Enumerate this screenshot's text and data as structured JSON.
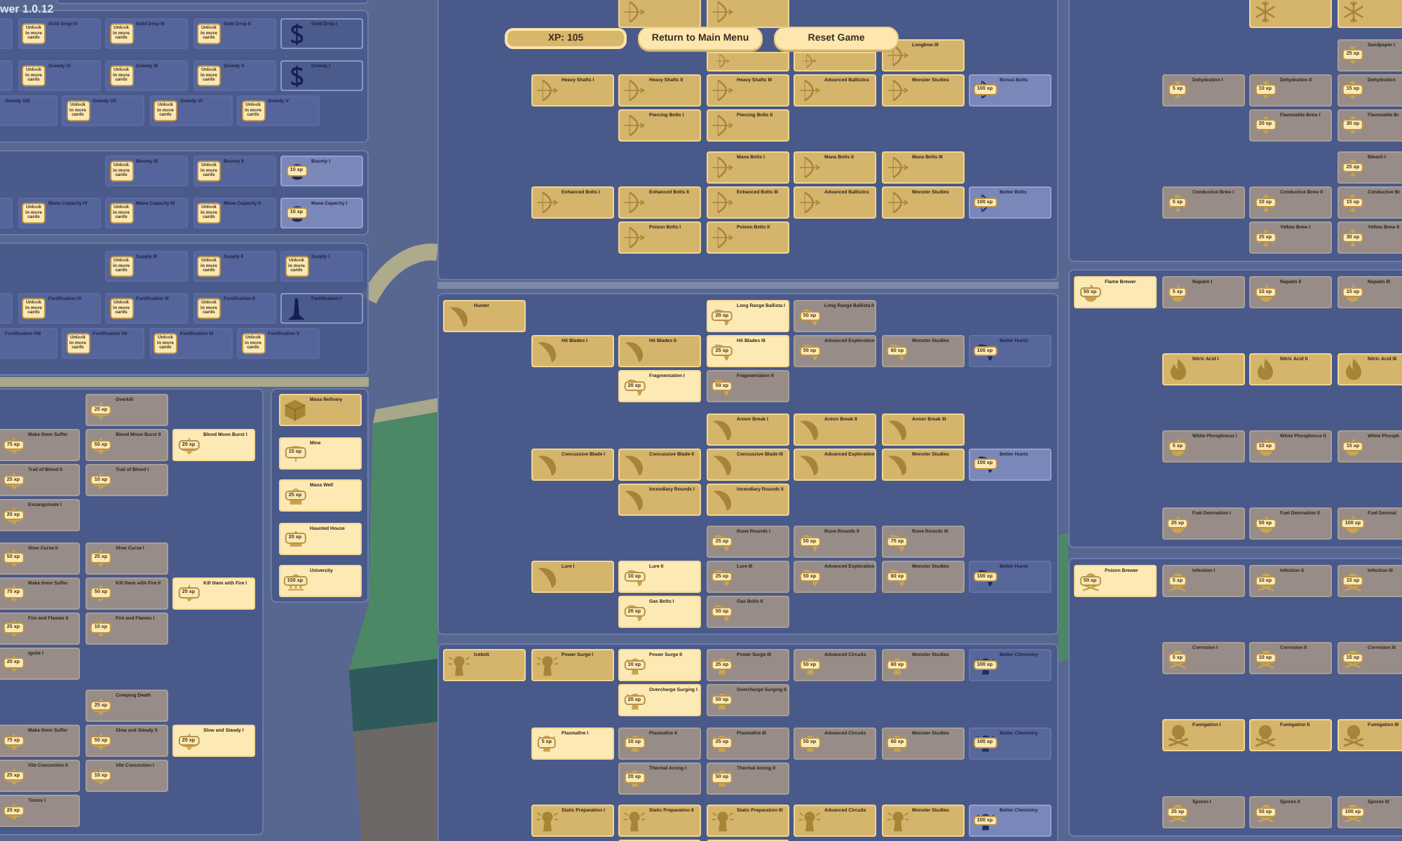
{
  "version": "wer 1.0.12",
  "hud": {
    "xp": "XP: 105",
    "buttons": [
      "Return to Main Menu",
      "Reset Game"
    ]
  },
  "upgrade_panels": [
    {
      "sections": [
        {
          "rows": [
            [
              {
                "kind": "sealed"
              },
              {
                "title": "Gold Drop IV",
                "kind": "sealed",
                "cost": "Unlock in more cards"
              },
              {
                "title": "Gold Drop III",
                "kind": "sealed",
                "cost": "Unlock in more cards"
              },
              {
                "title": "Gold Drop II",
                "kind": "sealed",
                "cost": "Unlock in more cards"
              },
              {
                "title": "Gold Drop I",
                "kind": "outlined"
              }
            ]
          ]
        },
        {
          "rows": [
            [
              {
                "kind": "sealed"
              },
              {
                "title": "Greedy IV",
                "kind": "sealed",
                "cost": "Unlock in more cards"
              },
              {
                "title": "Greedy III",
                "kind": "sealed",
                "cost": "Unlock in more cards"
              },
              {
                "title": "Greedy II",
                "kind": "sealed",
                "cost": "Unlock in more cards"
              },
              {
                "title": "Greedy I",
                "kind": "outlined"
              }
            ],
            [
              {
                "title": "Greedy VIII",
                "kind": "sealed"
              },
              {
                "title": "Greedy VII",
                "kind": "sealed",
                "cost": "Unlock in more cards"
              },
              {
                "title": "Greedy VI",
                "kind": "sealed",
                "cost": "Unlock in more cards"
              },
              {
                "title": "Greedy V",
                "kind": "sealed",
                "cost": "Unlock in more cards"
              }
            ]
          ]
        }
      ]
    },
    {
      "sections": [
        {
          "rows": [
            [
              {
                "title": "Bounty III",
                "kind": "sealed",
                "cost": "Unlock in more cards"
              },
              {
                "title": "Bounty II",
                "kind": "sealed",
                "cost": "Unlock in more cards"
              },
              {
                "title": "Bounty I",
                "kind": "capstone",
                "cost": "10 xp"
              }
            ]
          ]
        },
        {
          "rows": [
            [
              {
                "kind": "sealed"
              },
              {
                "title": "Mana Capacity IV",
                "kind": "sealed",
                "cost": "Unlock in more cards"
              },
              {
                "title": "Mana Capacity III",
                "kind": "sealed",
                "cost": "Unlock in more cards"
              },
              {
                "title": "Mana Capacity II",
                "kind": "sealed",
                "cost": "Unlock in more cards"
              },
              {
                "title": "Mana Capacity I",
                "kind": "capstone",
                "cost": "10 xp"
              }
            ]
          ]
        }
      ]
    },
    {
      "sections": [
        {
          "rows": [
            [
              {
                "title": "Supply III",
                "kind": "sealed",
                "cost": "Unlock in more cards"
              },
              {
                "title": "Supply II",
                "kind": "sealed",
                "cost": "Unlock in more cards"
              },
              {
                "title": "Supply I",
                "kind": "sealed",
                "cost": "Unlock in more cards"
              }
            ]
          ]
        },
        {
          "rows": [
            [
              {
                "kind": "sealed"
              },
              {
                "title": "Fortification IV",
                "kind": "sealed",
                "cost": "Unlock in more cards"
              },
              {
                "title": "Fortification III",
                "kind": "sealed",
                "cost": "Unlock in more cards"
              },
              {
                "title": "Fortification II",
                "kind": "sealed",
                "cost": "Unlock in more cards"
              },
              {
                "title": "Fortification I",
                "kind": "outlined"
              }
            ],
            [
              {
                "title": "Fortification VIII",
                "kind": "sealed"
              },
              {
                "title": "Fortification VII",
                "kind": "sealed",
                "cost": "Unlock in more cards"
              },
              {
                "title": "Fortification VI",
                "kind": "sealed",
                "cost": "Unlock in more cards"
              },
              {
                "title": "Fortification V",
                "kind": "sealed",
                "cost": "Unlock in more cards"
              }
            ]
          ]
        }
      ]
    }
  ],
  "curse_tree": {
    "sections": [
      {
        "rows": [
          [
            null,
            {
              "title": "Overkill",
              "kind": "locked",
              "cost": "25 xp"
            }
          ],
          [
            {
              "title": "Make them Suffer",
              "kind": "locked",
              "cost": "75 xp"
            },
            {
              "title": "Blood Moon Burst II",
              "kind": "locked",
              "cost": "50 xp"
            },
            {
              "title": "Blood Moon Burst I",
              "kind": "available",
              "cost": "20 xp"
            }
          ],
          [
            {
              "title": "Trail of Blood II",
              "kind": "locked",
              "cost": "25 xp"
            },
            {
              "title": "Trail of Blood I",
              "kind": "locked",
              "cost": "10 xp"
            }
          ],
          [
            {
              "title": "Exsanguinate I",
              "kind": "locked",
              "cost": "20 xp"
            }
          ]
        ]
      },
      {
        "rows": [
          [
            {
              "title": "Slow Curse II",
              "kind": "locked",
              "cost": "50 xp"
            },
            {
              "title": "Slow Curse I",
              "kind": "locked",
              "cost": "25 xp"
            }
          ],
          [
            {
              "title": "Make them Suffer",
              "kind": "locked",
              "cost": "75 xp"
            },
            {
              "title": "Kill them with Fire II",
              "kind": "locked",
              "cost": "50 xp"
            },
            {
              "title": "Kill them with Fire I",
              "kind": "available",
              "cost": "20 xp"
            }
          ],
          [
            {
              "title": "Fire and Flames II",
              "kind": "locked",
              "cost": "25 xp"
            },
            {
              "title": "Fire and Flames I",
              "kind": "locked",
              "cost": "10 xp"
            }
          ],
          [
            {
              "title": "Ignite I",
              "kind": "locked",
              "cost": "20 xp"
            }
          ]
        ]
      },
      {
        "rows": [
          [
            null,
            {
              "title": "Creeping Death",
              "kind": "locked",
              "cost": "25 xp"
            }
          ],
          [
            {
              "title": "Make them Suffer",
              "kind": "locked",
              "cost": "75 xp"
            },
            {
              "title": "Slow and Steady II",
              "kind": "locked",
              "cost": "50 xp"
            },
            {
              "title": "Slow and Steady I",
              "kind": "available",
              "cost": "20 xp"
            }
          ],
          [
            {
              "title": "Vile Concoction II",
              "kind": "locked",
              "cost": "25 xp"
            },
            {
              "title": "Vile Concoction I",
              "kind": "locked",
              "cost": "10 xp"
            }
          ],
          [
            {
              "title": "Toxins I",
              "kind": "locked",
              "cost": "20 xp"
            }
          ]
        ]
      }
    ]
  },
  "buildings": [
    {
      "title": "Mana Refinery",
      "kind": "owned"
    },
    {
      "title": "Mine",
      "kind": "available",
      "cost": "15 xp"
    },
    {
      "title": "Mana Well",
      "kind": "available",
      "cost": "25 xp"
    },
    {
      "title": "Haunted House",
      "kind": "available",
      "cost": "20 xp"
    },
    {
      "title": "University",
      "kind": "available",
      "cost": "150 xp"
    }
  ],
  "center_panels": [
    {
      "sections": [
        {
          "rows": [
            [
              null,
              null,
              {
                "kind": "owned"
              },
              {
                "kind": "owned"
              }
            ]
          ]
        },
        {
          "rows": [
            [
              null,
              null,
              null,
              {
                "kind": "owned"
              },
              {
                "kind": "owned"
              },
              {
                "title": "Longbow III",
                "kind": "owned"
              }
            ],
            [
              null,
              {
                "title": "Heavy Shafts I",
                "kind": "owned"
              },
              {
                "title": "Heavy Shafts II",
                "kind": "owned"
              },
              {
                "title": "Heavy Shafts III",
                "kind": "owned"
              },
              {
                "title": "Advanced Ballistics",
                "kind": "owned"
              },
              {
                "title": "Monster Studies",
                "kind": "owned"
              },
              {
                "title": "Bonus Bolts",
                "kind": "capstone",
                "cost": "100 xp"
              }
            ],
            [
              null,
              null,
              {
                "title": "Piercing Bolts I",
                "kind": "owned"
              },
              {
                "title": "Piercing Bolts II",
                "kind": "owned"
              }
            ]
          ]
        },
        {
          "rows": [
            [
              null,
              null,
              null,
              {
                "title": "Mana Bolts I",
                "kind": "owned"
              },
              {
                "title": "Mana Bolts II",
                "kind": "owned"
              },
              {
                "title": "Mana Bolts III",
                "kind": "owned"
              }
            ],
            [
              null,
              {
                "title": "Enhanced Bolts I",
                "kind": "owned"
              },
              {
                "title": "Enhanced Bolts II",
                "kind": "owned"
              },
              {
                "title": "Enhanced Bolts III",
                "kind": "owned"
              },
              {
                "title": "Advanced Ballistics",
                "kind": "owned"
              },
              {
                "title": "Monster Studies",
                "kind": "owned"
              },
              {
                "title": "Better Bolts",
                "kind": "capstone",
                "cost": "100 xp"
              }
            ],
            [
              null,
              null,
              {
                "title": "Poison Bolts I",
                "kind": "owned"
              },
              {
                "title": "Poison Bolts II",
                "kind": "owned"
              }
            ]
          ]
        }
      ]
    },
    {
      "sections": [
        {
          "rows": [
            [
              {
                "title": "Hunter",
                "kind": "owned"
              },
              null,
              null,
              {
                "title": "Long Range Ballista I",
                "kind": "available",
                "cost": "20 xp"
              },
              {
                "title": "Long Range Ballista II",
                "kind": "locked",
                "cost": "50 xp"
              }
            ],
            [
              null,
              {
                "title": "Hit Blades I",
                "kind": "owned"
              },
              {
                "title": "Hit Blades II",
                "kind": "owned"
              },
              {
                "title": "Hit Blades III",
                "kind": "available",
                "cost": "25 xp"
              },
              {
                "title": "Advanced Exploration",
                "kind": "locked",
                "cost": "50 xp"
              },
              {
                "title": "Monster Studies",
                "kind": "locked",
                "cost": "60 xp"
              },
              {
                "title": "Better Hunts",
                "kind": "capstone_locked",
                "cost": "100 xp"
              }
            ],
            [
              null,
              null,
              {
                "title": "Fragmentation I",
                "kind": "available",
                "cost": "20 xp"
              },
              {
                "title": "Fragmentation II",
                "kind": "locked",
                "cost": "50 xp"
              }
            ]
          ]
        },
        {
          "rows": [
            [
              null,
              null,
              null,
              {
                "title": "Armor Break I",
                "kind": "owned"
              },
              {
                "title": "Armor Break II",
                "kind": "owned"
              },
              {
                "title": "Armor Break III",
                "kind": "owned"
              }
            ],
            [
              null,
              {
                "title": "Concussive Blade I",
                "kind": "owned"
              },
              {
                "title": "Concussive Blade II",
                "kind": "owned"
              },
              {
                "title": "Concussive Blade III",
                "kind": "owned"
              },
              {
                "title": "Advanced Exploration",
                "kind": "owned"
              },
              {
                "title": "Monster Studies",
                "kind": "owned"
              },
              {
                "title": "Better Hunts",
                "kind": "capstone",
                "cost": "100 xp"
              }
            ],
            [
              null,
              null,
              {
                "title": "Incendiary Rounds I",
                "kind": "owned"
              },
              {
                "title": "Incendiary Rounds II",
                "kind": "owned"
              }
            ]
          ]
        },
        {
          "rows": [
            [
              null,
              null,
              null,
              {
                "title": "Rune Rounds I",
                "kind": "locked",
                "cost": "25 xp"
              },
              {
                "title": "Rune Rounds II",
                "kind": "locked",
                "cost": "50 xp"
              },
              {
                "title": "Rune Rounds III",
                "kind": "locked",
                "cost": "75 xp"
              }
            ],
            [
              null,
              {
                "title": "Lure I",
                "kind": "owned"
              },
              {
                "title": "Lure II",
                "kind": "available",
                "cost": "10 xp"
              },
              {
                "title": "Lure III",
                "kind": "locked",
                "cost": "25 xp"
              },
              {
                "title": "Advanced Exploration",
                "kind": "locked",
                "cost": "50 xp"
              },
              {
                "title": "Monster Studies",
                "kind": "locked",
                "cost": "60 xp"
              },
              {
                "title": "Better Hunts",
                "kind": "capstone_locked",
                "cost": "100 xp"
              }
            ],
            [
              null,
              null,
              {
                "title": "Gas Bolts I",
                "kind": "available",
                "cost": "20 xp"
              },
              {
                "title": "Gas Bolts II",
                "kind": "locked",
                "cost": "50 xp"
              }
            ]
          ]
        }
      ]
    },
    {
      "sections": [
        {
          "rows": [
            [
              {
                "title": "Icebolt",
                "kind": "owned"
              },
              {
                "title": "Power Surge I",
                "kind": "owned"
              },
              {
                "title": "Power Surge II",
                "kind": "available",
                "cost": "10 xp"
              },
              {
                "title": "Power Surge III",
                "kind": "locked",
                "cost": "25 xp"
              },
              {
                "title": "Advanced Circuits",
                "kind": "locked",
                "cost": "50 xp"
              },
              {
                "title": "Monster Studies",
                "kind": "locked",
                "cost": "60 xp"
              },
              {
                "title": "Better Chemistry",
                "kind": "capstone_locked",
                "cost": "100 xp"
              }
            ],
            [
              null,
              null,
              {
                "title": "Overcharge Surging I",
                "kind": "available",
                "cost": "20 xp"
              },
              {
                "title": "Overcharge Surging II",
                "kind": "locked",
                "cost": "50 xp"
              }
            ]
          ]
        },
        {
          "rows": [
            [
              null,
              {
                "title": "Plasmafire I",
                "kind": "available",
                "cost": "5 xp"
              },
              {
                "title": "Plasmafire II",
                "kind": "locked",
                "cost": "10 xp"
              },
              {
                "title": "Plasmafire III",
                "kind": "locked",
                "cost": "25 xp"
              },
              {
                "title": "Advanced Circuits",
                "kind": "locked",
                "cost": "50 xp"
              },
              {
                "title": "Monster Studies",
                "kind": "locked",
                "cost": "60 xp"
              },
              {
                "title": "Better Chemistry",
                "kind": "capstone_locked",
                "cost": "100 xp"
              }
            ],
            [
              null,
              null,
              {
                "title": "Thermal Arcing I",
                "kind": "locked",
                "cost": "20 xp"
              },
              {
                "title": "Thermal Arcing II",
                "kind": "locked",
                "cost": "50 xp"
              }
            ]
          ]
        },
        {
          "rows": [
            [
              null,
              {
                "title": "Static Preparation I",
                "kind": "owned"
              },
              {
                "title": "Static Preparation II",
                "kind": "owned"
              },
              {
                "title": "Static Preparation III",
                "kind": "owned"
              },
              {
                "title": "Advanced Circuits",
                "kind": "owned"
              },
              {
                "title": "Monster Studies",
                "kind": "owned"
              },
              {
                "title": "Better Chemistry",
                "kind": "capstone",
                "cost": "100 xp"
              }
            ],
            [
              null,
              null,
              {
                "kind": "owned"
              },
              {
                "kind": "owned"
              }
            ]
          ]
        }
      ]
    }
  ],
  "right_panels": [
    {
      "sections": [
        {
          "rows": [
            [
              null,
              null,
              {
                "kind": "owned"
              },
              {
                "kind": "owned"
              }
            ]
          ]
        },
        {
          "rows": [
            [
              null,
              null,
              null,
              {
                "title": "Sandpaper I",
                "kind": "locked",
                "cost": "25 xp"
              }
            ],
            [
              null,
              {
                "title": "Dehydration I",
                "kind": "locked",
                "cost": "5 xp"
              },
              {
                "title": "Dehydration II",
                "kind": "locked",
                "cost": "10 xp"
              },
              {
                "title": "Dehydration",
                "kind": "locked",
                "cost": "15 xp"
              }
            ],
            [
              null,
              null,
              {
                "title": "Flammable Brew I",
                "kind": "locked",
                "cost": "20 xp"
              },
              {
                "title": "Flammable Br",
                "kind": "locked",
                "cost": "30 xp"
              }
            ]
          ]
        },
        {
          "rows": [
            [
              null,
              null,
              null,
              {
                "title": "Bleach I",
                "kind": "locked",
                "cost": "25 xp"
              }
            ],
            [
              null,
              {
                "title": "Conductive Brew I",
                "kind": "locked",
                "cost": "5 xp"
              },
              {
                "title": "Conductive Brew II",
                "kind": "locked",
                "cost": "10 xp"
              },
              {
                "title": "Conductive Br",
                "kind": "locked",
                "cost": "15 xp"
              }
            ],
            [
              null,
              null,
              {
                "title": "Yellow Brew I",
                "kind": "locked",
                "cost": "25 xp"
              },
              {
                "title": "Yellow Brew II",
                "kind": "locked",
                "cost": "30 xp"
              }
            ]
          ]
        }
      ]
    },
    {
      "sections": [
        {
          "rows": [
            [
              {
                "title": "Flame Brewer",
                "kind": "available",
                "cost": "50 xp"
              },
              {
                "title": "Napalm I",
                "kind": "locked",
                "cost": "5 xp"
              },
              {
                "title": "Napalm II",
                "kind": "locked",
                "cost": "10 xp"
              },
              {
                "title": "Napalm III",
                "kind": "locked",
                "cost": "15 xp"
              }
            ]
          ]
        },
        {
          "rows": [
            [
              null,
              {
                "title": "Nitric Acid I",
                "kind": "owned"
              },
              {
                "title": "Nitric Acid II",
                "kind": "owned"
              },
              {
                "title": "Nitric Acid III",
                "kind": "owned"
              }
            ]
          ]
        },
        {
          "rows": [
            [
              null,
              {
                "title": "White Phosphorus I",
                "kind": "locked",
                "cost": "5 xp"
              },
              {
                "title": "White Phosphorus II",
                "kind": "locked",
                "cost": "10 xp"
              },
              {
                "title": "White Phosph",
                "kind": "locked",
                "cost": "15 xp"
              }
            ]
          ]
        },
        {
          "rows": [
            [
              null,
              {
                "title": "Fuel Detonation I",
                "kind": "locked",
                "cost": "25 xp"
              },
              {
                "title": "Fuel Detonation II",
                "kind": "locked",
                "cost": "50 xp"
              },
              {
                "title": "Fuel Detonat",
                "kind": "locked",
                "cost": "100 xp"
              }
            ]
          ]
        }
      ]
    },
    {
      "sections": [
        {
          "rows": [
            [
              {
                "title": "Poison Brewer",
                "kind": "available",
                "cost": "50 xp"
              },
              {
                "title": "Infection I",
                "kind": "locked",
                "cost": "5 xp"
              },
              {
                "title": "Infection II",
                "kind": "locked",
                "cost": "10 xp"
              },
              {
                "title": "Infection III",
                "kind": "locked",
                "cost": "15 xp"
              }
            ]
          ]
        },
        {
          "rows": [
            [
              null,
              {
                "title": "Corrosion I",
                "kind": "locked",
                "cost": "5 xp"
              },
              {
                "title": "Corrosion II",
                "kind": "locked",
                "cost": "10 xp"
              },
              {
                "title": "Corrosion III",
                "kind": "locked",
                "cost": "15 xp"
              }
            ]
          ]
        },
        {
          "rows": [
            [
              null,
              {
                "title": "Fumigation I",
                "kind": "owned"
              },
              {
                "title": "Fumigation II",
                "kind": "owned"
              },
              {
                "title": "Fumigation III",
                "kind": "owned"
              }
            ]
          ]
        },
        {
          "rows": [
            [
              null,
              {
                "title": "Spores I",
                "kind": "locked",
                "cost": "25 xp"
              },
              {
                "title": "Spores II",
                "kind": "locked",
                "cost": "50 xp"
              },
              {
                "title": "Spores III",
                "kind": "locked",
                "cost": "100 xp"
              }
            ]
          ]
        }
      ]
    }
  ]
}
